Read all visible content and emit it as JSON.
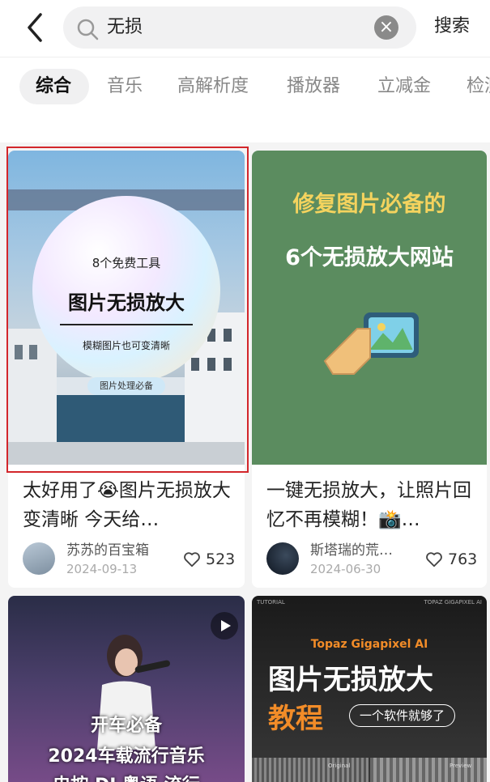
{
  "search": {
    "query": "无损",
    "search_button": "搜索"
  },
  "tabs": [
    {
      "label": "综合",
      "active": true
    },
    {
      "label": "音乐",
      "active": false
    },
    {
      "label": "高解析度",
      "active": false
    },
    {
      "label": "播放器",
      "active": false
    },
    {
      "label": "立减金",
      "active": false
    },
    {
      "label": "检测",
      "active": false
    }
  ],
  "cards": [
    {
      "image": {
        "line1": "8个免费工具",
        "line2": "图片无损放大",
        "line3": "模糊图片也可变清晰",
        "tag": "图片处理必备"
      },
      "title": "太好用了😭图片无损放大变清晰 今天给…",
      "author": "苏苏的百宝箱",
      "date": "2024-09-13",
      "likes": "523"
    },
    {
      "image": {
        "line1": "修复图片必备的",
        "line2": "6个无损放大网站"
      },
      "title": "一键无损放大，让照片回忆不再模糊！📸…",
      "author": "斯塔瑞的荒…",
      "date": "2024-06-30",
      "likes": "763"
    },
    {
      "image": {
        "line1": "开车必备",
        "line2": "2024车载流行音乐",
        "line3": "电按 DJ 粤语 流行"
      }
    },
    {
      "image": {
        "corner_left": "TUTORIAL",
        "corner_right": "TOPAZ GIGAPIXEL AI",
        "brand": "Topaz Gigapixel AI",
        "line1": "图片无损放大",
        "line2": "教程",
        "pill": "一个软件就够了",
        "label_left": "Original",
        "label_right": "Preview"
      }
    }
  ],
  "colors": {
    "accent_red": "#d3262b",
    "card2_bg": "#5b8c5f",
    "card2_title": "#f4d35e"
  }
}
